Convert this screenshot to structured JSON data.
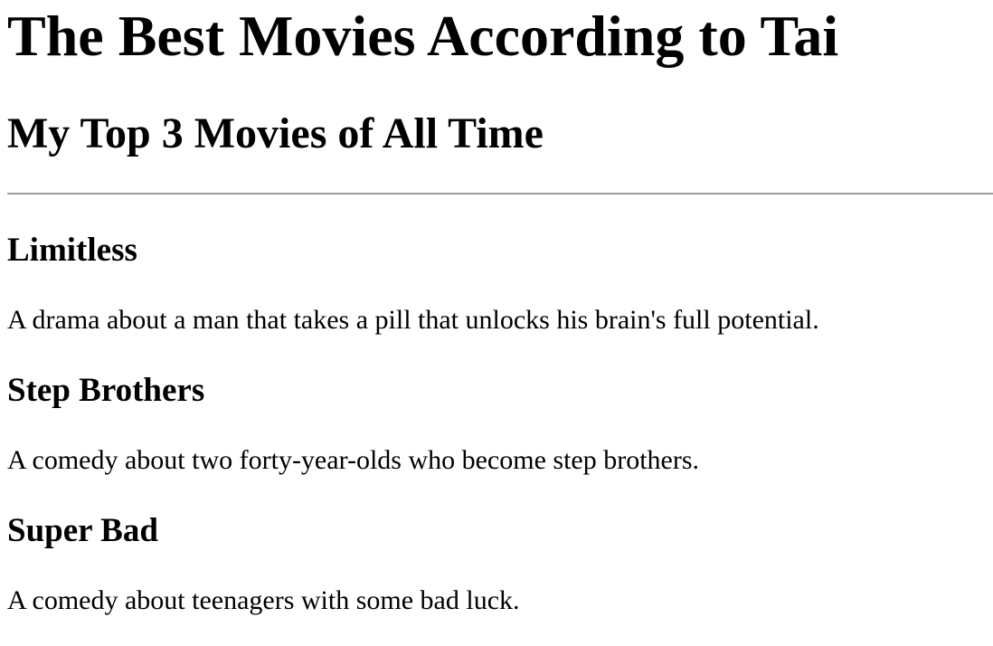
{
  "page": {
    "title": "The Best Movies According to Tai",
    "subtitle": "My Top 3 Movies of All Time"
  },
  "movies": [
    {
      "title": "Limitless",
      "description": "A drama about a man that takes a pill that unlocks his brain's full potential."
    },
    {
      "title": "Step Brothers",
      "description": "A comedy about two forty-year-olds who become step brothers."
    },
    {
      "title": "Super Bad",
      "description": "A comedy about teenagers with some bad luck."
    }
  ]
}
